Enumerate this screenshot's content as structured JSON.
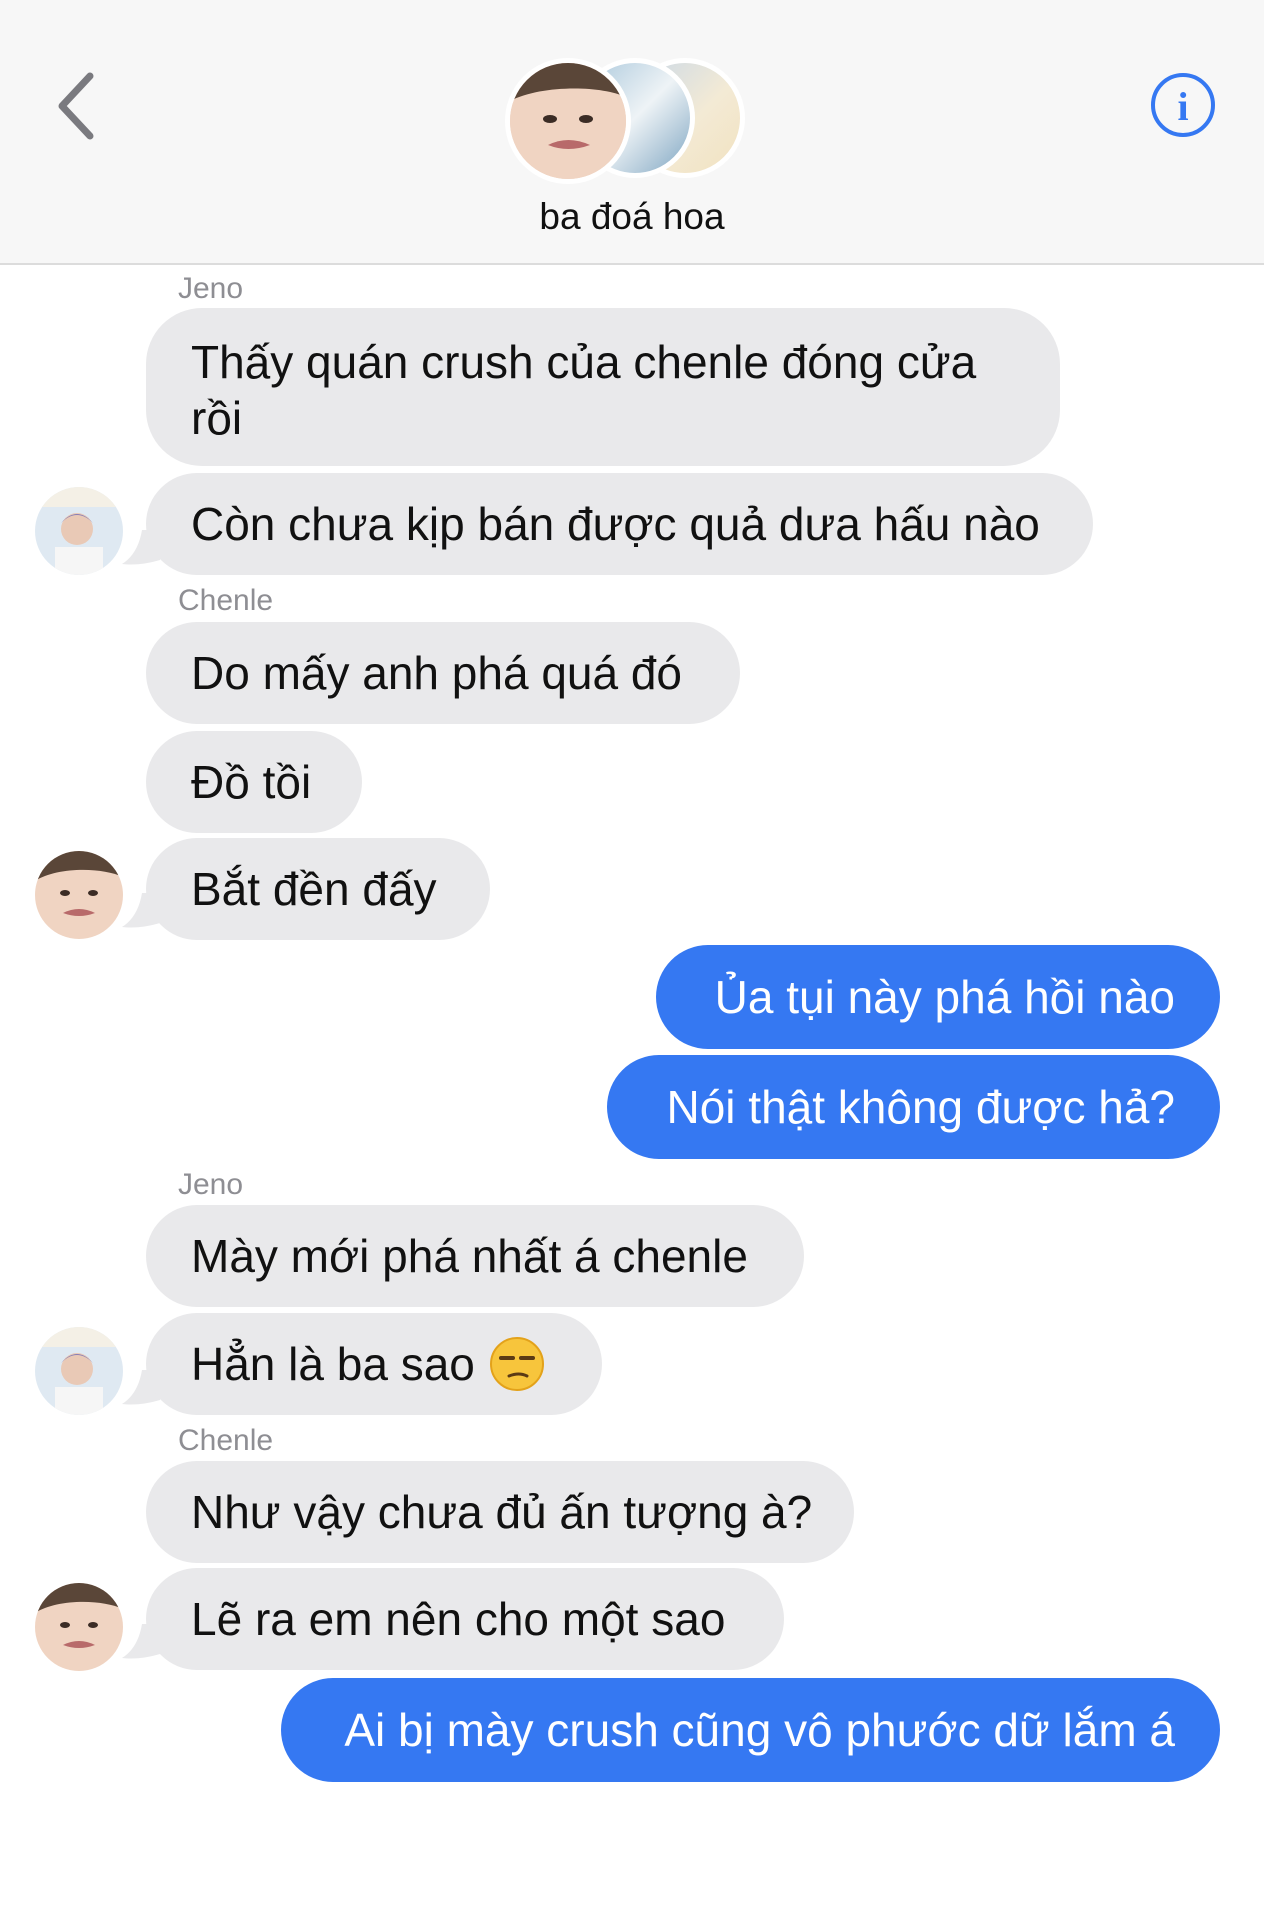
{
  "header": {
    "back_icon": "chevron-left-icon",
    "info_icon": "info-circle-icon",
    "title": "ba đoá hoa",
    "accent_color": "#3578f2"
  },
  "messages": [
    {
      "sender": "Jeno"
    },
    {
      "text": "Thấy quán crush của chenle đóng cửa rồi"
    },
    {
      "text": "Còn chưa kịp bán được quả dưa hấu nào"
    },
    {
      "sender": "Chenle"
    },
    {
      "text": "Do mấy anh phá quá đó"
    },
    {
      "text": "Đồ tồi"
    },
    {
      "text": "Bắt đền đấy"
    },
    {
      "text": "Ủa tụi này phá hồi nào"
    },
    {
      "text": "Nói thật không được hả?"
    },
    {
      "sender": "Jeno"
    },
    {
      "text": "Mày mới phá nhất á chenle"
    },
    {
      "text": "Hẳn là ba sao",
      "emoji": "unamused-face-icon"
    },
    {
      "sender": "Chenle"
    },
    {
      "text": "Như vậy chưa đủ ấn tượng à?"
    },
    {
      "text": "Lẽ ra em nên cho một sao"
    },
    {
      "text": "Ai bị mày crush cũng vô phước dữ lắm á"
    }
  ]
}
